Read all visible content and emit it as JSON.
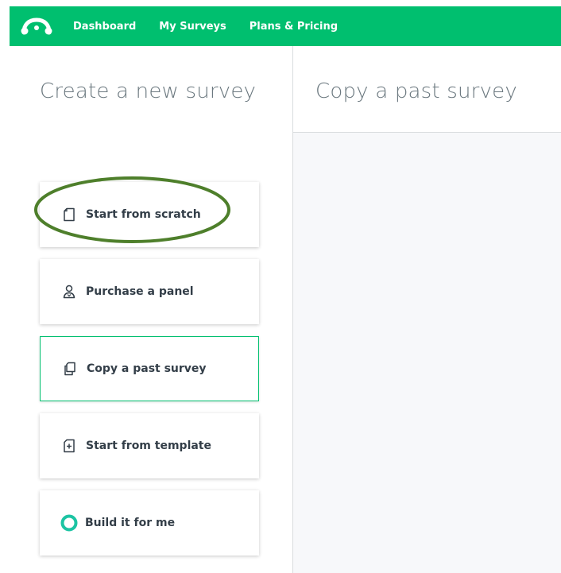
{
  "nav": {
    "logo_icon": "monkey-logo-icon",
    "links": [
      "Dashboard",
      "My Surveys",
      "Plans & Pricing"
    ]
  },
  "left": {
    "heading": "Create a new survey",
    "options": [
      {
        "label": "Start from scratch",
        "icon": "blank-page-icon"
      },
      {
        "label": "Purchase a panel",
        "icon": "person-icon"
      },
      {
        "label": "Copy a past survey",
        "icon": "copy-pages-icon",
        "selected": true
      },
      {
        "label": "Start from template",
        "icon": "template-add-icon"
      },
      {
        "label": "Build it for me",
        "icon": "ring-icon"
      }
    ]
  },
  "right": {
    "heading": "Copy a past survey"
  },
  "colors": {
    "brand_green": "#00bf6f",
    "annotation_green": "#4e7f2b",
    "ring_teal": "#1cc4a3"
  }
}
